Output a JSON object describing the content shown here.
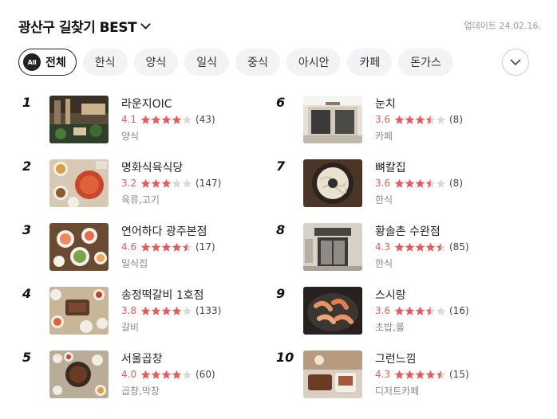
{
  "header": {
    "title": "광산구 길찾기 BEST",
    "updated": "업데이트 24.02.16."
  },
  "chips": {
    "all_badge": "All",
    "all_label": "전체",
    "items": [
      "한식",
      "양식",
      "일식",
      "중식",
      "아시안",
      "카페",
      "돈가스"
    ]
  },
  "colors": {
    "star_filled": "#e85b5b",
    "star_empty": "#d9d9d9",
    "score": "#e85b5b"
  },
  "items": [
    {
      "rank": "1",
      "name": "라운지OIC",
      "score": "4.1",
      "stars": 4.0,
      "count": "(43)",
      "category": "양식",
      "thumb": "thumb-lounge-interior"
    },
    {
      "rank": "2",
      "name": "명화식육식당",
      "score": "3.2",
      "stars": 3.0,
      "count": "(147)",
      "category": "육류,고기",
      "thumb": "thumb-stew-table"
    },
    {
      "rank": "3",
      "name": "연어하다 광주본점",
      "score": "4.6",
      "stars": 4.5,
      "count": "(17)",
      "category": "일식집",
      "thumb": "thumb-sushi-spread"
    },
    {
      "rank": "4",
      "name": "송정떡갈비 1호점",
      "score": "3.8",
      "stars": 4.0,
      "count": "(133)",
      "category": "갈비",
      "thumb": "thumb-galbi-table"
    },
    {
      "rank": "5",
      "name": "서울곱창",
      "score": "4.0",
      "stars": 4.0,
      "count": "(60)",
      "category": "곱창,막창",
      "thumb": "thumb-gopchang-table"
    },
    {
      "rank": "6",
      "name": "눈치",
      "score": "3.6",
      "stars": 3.5,
      "count": "(8)",
      "category": "카페",
      "thumb": "thumb-cafe-storefront"
    },
    {
      "rank": "7",
      "name": "뼈칼집",
      "score": "3.6",
      "stars": 3.5,
      "count": "(8)",
      "category": "한식",
      "thumb": "thumb-noodle-bowl"
    },
    {
      "rank": "8",
      "name": "황솔촌 수완점",
      "score": "4.3",
      "stars": 4.5,
      "count": "(85)",
      "category": "한식",
      "thumb": "thumb-restaurant-entrance"
    },
    {
      "rank": "9",
      "name": "스시랑",
      "score": "3.6",
      "stars": 3.5,
      "count": "(16)",
      "category": "초밥,롤",
      "thumb": "thumb-shrimp-plate"
    },
    {
      "rank": "10",
      "name": "그런느낌",
      "score": "4.3",
      "stars": 4.5,
      "count": "(15)",
      "category": "디저트카페",
      "thumb": "thumb-cafe-dessert"
    }
  ]
}
